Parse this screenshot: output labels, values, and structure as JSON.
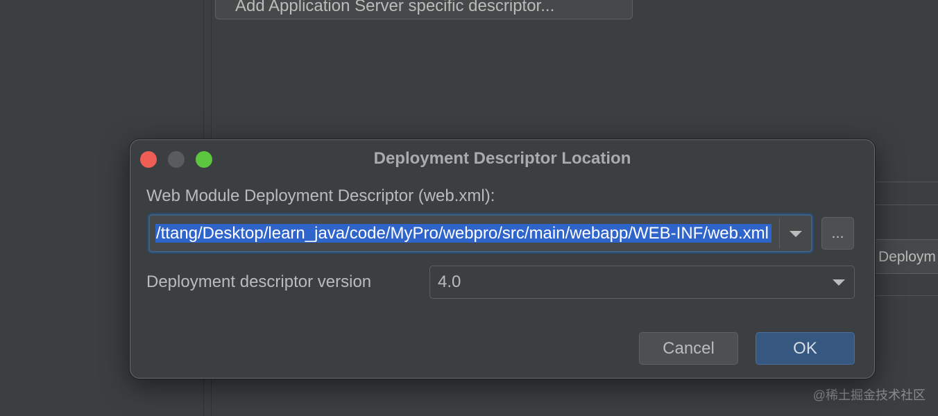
{
  "background": {
    "add_descriptor_button": "Add Application Server specific descriptor...",
    "right_button_partial": "Deploym",
    "watermark": "@稀土掘金技术社区"
  },
  "dialog": {
    "title": "Deployment Descriptor Location",
    "descriptor_label": "Web Module Deployment Descriptor (web.xml):",
    "descriptor_path": "/Users/ttang/Desktop/learn_java/code/MyPro/webpro/src/main/webapp/WEB-INF/web.xml",
    "browse_label": "...",
    "version_label": "Deployment descriptor version",
    "version_value": "4.0",
    "cancel_label": "Cancel",
    "ok_label": "OK"
  },
  "icons": {
    "window_close": "traffic-light-red",
    "window_minimize": "traffic-light-grey",
    "window_zoom": "traffic-light-green",
    "dropdown": "chevron-down-icon"
  },
  "colors": {
    "selection": "#2f65ca",
    "ok_button": "#365880",
    "focus_border": "#3d6185"
  }
}
